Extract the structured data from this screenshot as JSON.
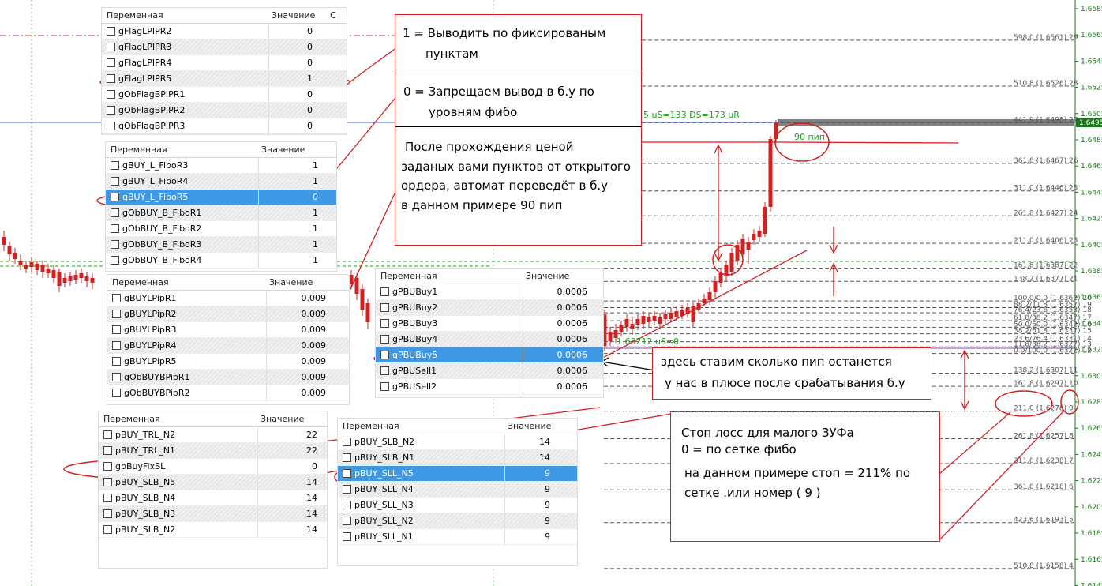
{
  "chart": {
    "fibo_levels": [
      {
        "label": "598.0 (1.6561) 29",
        "price": 1.6561
      },
      {
        "label": "510.8 (1.6526) 28",
        "price": 1.6526
      },
      {
        "label": "441.9 (1.6498) 27",
        "price": 1.6498
      },
      {
        "label": "361.8 (1.6467) 26",
        "price": 1.6467
      },
      {
        "label": "311.0 (1.6446) 25",
        "price": 1.6446
      },
      {
        "label": "261.8 (1.6427) 24",
        "price": 1.6427
      },
      {
        "label": "211.0 (1.6406) 23",
        "price": 1.6406
      },
      {
        "label": "161.8 (1.6387) 22",
        "price": 1.6387
      },
      {
        "label": "138.2 (1.6377) 21",
        "price": 1.6377
      },
      {
        "label": "100.0/0.0 (1.6362) 20",
        "price": 1.6362
      },
      {
        "label": "88.2/11.8 (1.6357) 19",
        "price": 1.6357
      },
      {
        "label": "76.4/23.6 (1.6353) 18",
        "price": 1.6353
      },
      {
        "label": "61.8/38.2 (1.6347) 17",
        "price": 1.6347
      },
      {
        "label": "50.0/50.0 (1.6342) 16",
        "price": 1.6342
      },
      {
        "label": "38.2/61.8 (1.6337) 15",
        "price": 1.6337
      },
      {
        "label": "23.6/76.4 (1.6331) 14",
        "price": 1.6331
      },
      {
        "label": "11.8/88.2 (1.6327) 13",
        "price": 1.6327
      },
      {
        "label": "0.0/100.0 (1.6322) 12",
        "price": 1.6322
      },
      {
        "label": "138.2 (1.6307) 11",
        "price": 1.6307
      },
      {
        "label": "161.8 (1.6297) 10",
        "price": 1.6297
      },
      {
        "label": "211.0 (1.6278) 9",
        "price": 1.6278
      },
      {
        "label": "261.8 (1.6257) 8",
        "price": 1.6257
      },
      {
        "label": "311.0 (1.6238) 7",
        "price": 1.6238
      },
      {
        "label": "361.0 (1.6218) 6",
        "price": 1.6218
      },
      {
        "label": "423.6 (1.6193) 5",
        "price": 1.6193
      },
      {
        "label": "510.8 (1.6158) 4",
        "price": 1.6158
      }
    ],
    "price_axis": [
      "1.6585",
      "1.6565",
      "1.6545",
      "1.6525",
      "1.6505",
      "1.6485",
      "1.6465",
      "1.6445",
      "1.6425",
      "1.6405",
      "1.6385",
      "1.6365",
      "1.6345",
      "1.6325",
      "1.6305",
      "1.6285",
      "1.6265",
      "1.6245",
      "1.6225",
      "1.6205",
      "1.6185",
      "1.6165",
      "1.6145"
    ],
    "current_price": "1.6495",
    "green_text_top": "5 uS=133 DS=173 uR",
    "green_text_bottom": "1.63212 uS=0",
    "pip_label": "90 пип",
    "colors": {
      "bull": "#1aa51a",
      "bear": "#d42020",
      "fibo": "#444444",
      "axis": "#1a7a1a",
      "blue": "#3a5fd8",
      "annot": "#d42020"
    }
  },
  "panels": {
    "p1": {
      "header": {
        "name": "Переменная",
        "value": "Значение",
        "extra": "С"
      },
      "rows": [
        {
          "name": "gFlagLPIPR2",
          "value": "0"
        },
        {
          "name": "gFlagLPIPR3",
          "value": "0"
        },
        {
          "name": "gFlagLPIPR4",
          "value": "0"
        },
        {
          "name": "gFlagLPIPR5",
          "value": "1"
        },
        {
          "name": "gObFlagBPIPR1",
          "value": "0"
        },
        {
          "name": "gObFlagBPIPR2",
          "value": "0"
        },
        {
          "name": "gObFlagBPIPR3",
          "value": "0"
        }
      ]
    },
    "p2": {
      "header": {
        "name": "Переменная",
        "value": "Значение"
      },
      "rows": [
        {
          "name": "gBUY_L_FiboR3",
          "value": "1"
        },
        {
          "name": "gBUY_L_FiboR4",
          "value": "1"
        },
        {
          "name": "gBUY_L_FiboR5",
          "value": "0"
        },
        {
          "name": "gObBUY_B_FiboR1",
          "value": "1"
        },
        {
          "name": "gObBUY_B_FiboR2",
          "value": "1"
        },
        {
          "name": "gObBUY_B_FiboR3",
          "value": "1"
        },
        {
          "name": "gObBUY_B_FiboR4",
          "value": "1"
        }
      ]
    },
    "p3": {
      "header": {
        "name": "Переменная",
        "value": "Значение"
      },
      "rows": [
        {
          "name": "gBUYLPipR1",
          "value": "0.009"
        },
        {
          "name": "gBUYLPipR2",
          "value": "0.009"
        },
        {
          "name": "gBUYLPipR3",
          "value": "0.009"
        },
        {
          "name": "gBUYLPipR4",
          "value": "0.009"
        },
        {
          "name": "gBUYLPipR5",
          "value": "0.009"
        },
        {
          "name": "gObBUYBPipR1",
          "value": "0.009"
        },
        {
          "name": "gObBUYBPipR2",
          "value": "0.009"
        }
      ]
    },
    "p4": {
      "header": {
        "name": "Переменная",
        "value": "Значение"
      },
      "rows": [
        {
          "name": "gPBUBuy1",
          "value": "0.0006"
        },
        {
          "name": "gPBUBuy2",
          "value": "0.0006"
        },
        {
          "name": "gPBUBuy3",
          "value": "0.0006"
        },
        {
          "name": "gPBUBuy4",
          "value": "0.0006"
        },
        {
          "name": "gPBUBuy5",
          "value": "0.0006"
        },
        {
          "name": "gPBUSell1",
          "value": "0.0006"
        },
        {
          "name": "gPBUSell2",
          "value": "0.0006"
        }
      ]
    },
    "p5": {
      "header": {
        "name": "Переменная",
        "value": "Значение"
      },
      "rows": [
        {
          "name": "pBUY_TRL_N2",
          "value": "22"
        },
        {
          "name": "pBUY_TRL_N1",
          "value": "22"
        },
        {
          "name": "gpBuyFixSL",
          "value": "0"
        },
        {
          "name": "pBUY_SLB_N5",
          "value": "14"
        },
        {
          "name": "pBUY_SLB_N4",
          "value": "14"
        },
        {
          "name": "pBUY_SLB_N3",
          "value": "14"
        },
        {
          "name": "pBUY_SLB_N2",
          "value": "14"
        }
      ]
    },
    "p6": {
      "header": {
        "name": "Переменная",
        "value": "Значение"
      },
      "rows": [
        {
          "name": "pBUY_SLB_N2",
          "value": "14"
        },
        {
          "name": "pBUY_SLB_N1",
          "value": "14"
        },
        {
          "name": "pBUY_SLL_N5",
          "value": "9"
        },
        {
          "name": "pBUY_SLL_N4",
          "value": "9"
        },
        {
          "name": "pBUY_SLL_N3",
          "value": "9"
        },
        {
          "name": "pBUY_SLL_N2",
          "value": "9"
        },
        {
          "name": "pBUY_SLL_N1",
          "value": "9"
        }
      ]
    }
  },
  "notes": {
    "n1": {
      "line1": "1 = Выводить по фиксированым",
      "line2": "пунктам",
      "line3": "0 = Запрещаем вывод в б.у по",
      "line4": "уровням фибо",
      "line5": "После прохождения ценой",
      "line6": "заданых вами пунктов от открытого",
      "line7": "ордера, автомат переведёт в б.у",
      "line8": "в данном примере  90 пип"
    },
    "n2": {
      "line1": "здесь ставим сколько пип останется",
      "line2": "у нас в плюсе после срабатывания б.у"
    },
    "n3": {
      "line1": "Стоп лосс  для малого ЗУФа",
      "line2": "0 = по сетке фибо",
      "line3": "на данном примере стоп = 211% по",
      "line4": "сетке .или номер ( 9 )"
    }
  }
}
